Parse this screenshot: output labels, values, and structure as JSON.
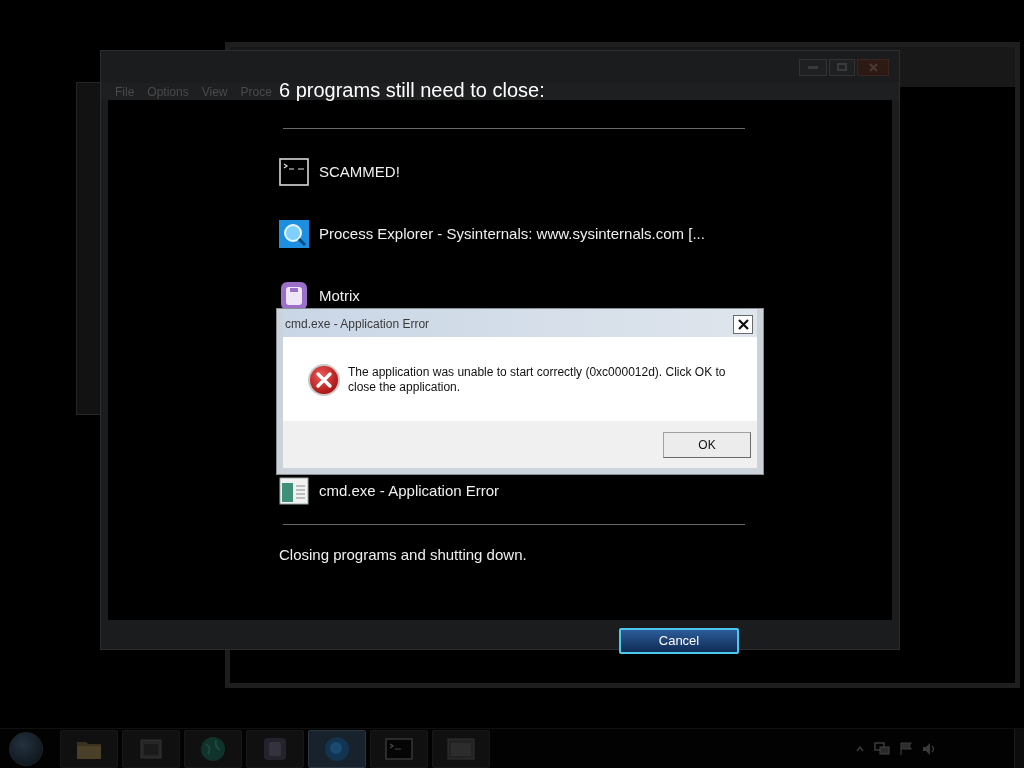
{
  "background_window": {
    "menu": [
      "File",
      "Options",
      "View",
      "Proce"
    ]
  },
  "shutdown_screen": {
    "heading": "6 programs still need to close:",
    "programs": [
      {
        "kind": "console",
        "name": "SCAMMED!"
      },
      {
        "kind": "process_explorer",
        "name": "Process Explorer - Sysinternals: www.sysinternals.com [..."
      },
      {
        "kind": "motrix",
        "name": "Motrix"
      },
      {
        "kind": "error_window",
        "name": "cmd.exe - Application Error"
      }
    ],
    "status": "Closing programs and shutting down.",
    "cancel_button": "Cancel"
  },
  "error_dialog": {
    "title": "cmd.exe - Application Error",
    "message": "The application was unable to start correctly (0xc000012d). Click OK to close the application.",
    "ok_button": "OK"
  },
  "taskbar": {
    "buttons": [
      {
        "kind": "folder",
        "selected": false
      },
      {
        "kind": "app",
        "selected": false
      },
      {
        "kind": "globe",
        "selected": false
      },
      {
        "kind": "motrix",
        "selected": false
      },
      {
        "kind": "process_explorer",
        "selected": true
      },
      {
        "kind": "console",
        "selected": false
      },
      {
        "kind": "window",
        "selected": false
      }
    ]
  }
}
